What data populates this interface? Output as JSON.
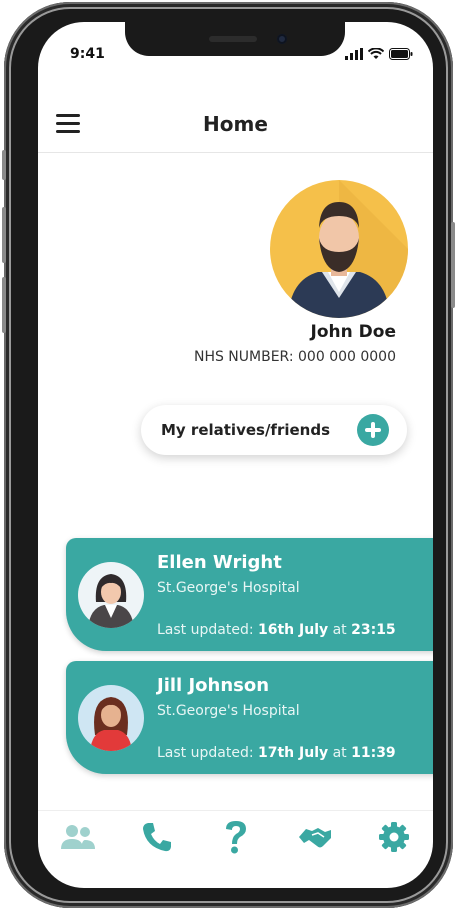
{
  "status": {
    "time": "9:41"
  },
  "header": {
    "title": "Home"
  },
  "profile": {
    "name": "John Doe",
    "nhs_number": "NHS NUMBER: 000 000 0000"
  },
  "relatives_button": {
    "label": "My relatives/friends"
  },
  "patients": [
    {
      "name": "Ellen Wright",
      "hospital": "St.George's Hospital",
      "updated_prefix": "Last updated:",
      "date": "16th July",
      "at": "at",
      "time": "23:15"
    },
    {
      "name": "Jill Johnson",
      "hospital": "St.George's Hospital",
      "updated_prefix": "Last updated:",
      "date": "17th July",
      "at": "at",
      "time": "11:39"
    }
  ],
  "tabbar": {
    "items": [
      "people-icon",
      "phone-icon",
      "question-icon",
      "handshake-icon",
      "gear-icon"
    ],
    "active": "people-icon"
  },
  "colors": {
    "accent": "#3aa8a2",
    "avatar_bg": "#f5c04a",
    "inactive_tab": "#9fd1cd"
  }
}
